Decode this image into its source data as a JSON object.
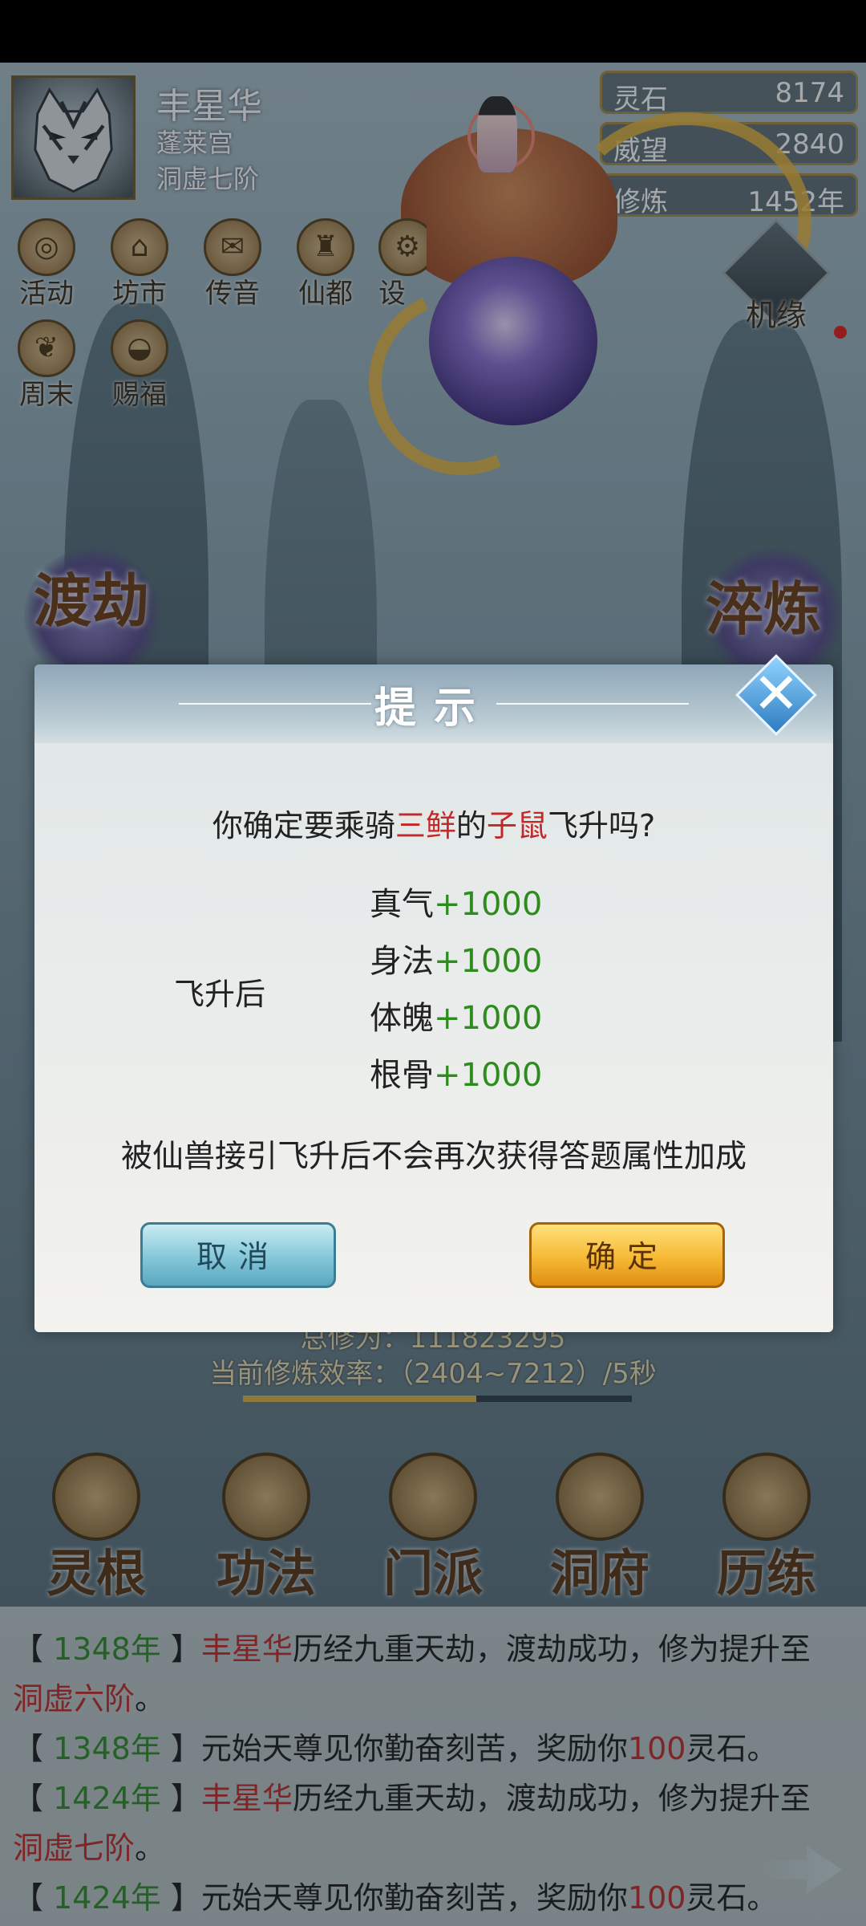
{
  "player": {
    "name": "丰星华",
    "sect": "蓬莱宫",
    "realm": "洞虚七阶"
  },
  "resources": [
    {
      "label": "灵石",
      "value": "8174"
    },
    {
      "label": "威望",
      "value": "2840"
    },
    {
      "label": "修炼",
      "value": "1452年"
    }
  ],
  "top_menu": {
    "row1": [
      "活动",
      "坊市",
      "传音",
      "仙都",
      "设"
    ],
    "row2": [
      "周末",
      "赐福"
    ],
    "jiyuan": "机缘"
  },
  "side_buttons": {
    "left": "渡劫",
    "right": "淬炼"
  },
  "cultivation": {
    "total_partial": "总修为：111823295",
    "rate": "当前修炼效率：（2404~7212）/5秒",
    "progress": 0.6
  },
  "bottom_nav": [
    "灵根",
    "功法",
    "门派",
    "洞府",
    "历练"
  ],
  "log": [
    {
      "year": "1348年",
      "name": "丰星华",
      "text": "历经九重天劫，渡劫成功，修为提升至",
      "realm": "洞虚六阶"
    },
    {
      "year": "1348年",
      "text_a": "元始天尊见你勤奋刻苦，奖励你",
      "amount": "100",
      "text_b": "灵石。"
    },
    {
      "year": "1424年",
      "name": "丰星华",
      "text": "历经九重天劫，渡劫成功，修为提升至",
      "realm": "洞虚七阶"
    },
    {
      "year": "1424年",
      "text_a": "元始天尊见你勤奋刻苦，奖励你",
      "amount": "100",
      "text_b": "灵石。"
    }
  ],
  "dialog": {
    "title": "提示",
    "question_a": "你确定要乘骑",
    "question_red1": "三鲜",
    "question_b": "的",
    "question_red2": "子鼠",
    "question_c": "飞升吗?",
    "after_label": "飞升后",
    "bonuses": [
      {
        "stat": "真气",
        "value": "+1000"
      },
      {
        "stat": "身法",
        "value": "+1000"
      },
      {
        "stat": "体魄",
        "value": "+1000"
      },
      {
        "stat": "根骨",
        "value": "+1000"
      }
    ],
    "note": "被仙兽接引飞升后不会再次获得答题属性加成",
    "cancel_label": "取消",
    "confirm_label": "确定"
  },
  "colors": {
    "green": "#2e8c1e",
    "red": "#c22a2a",
    "gold": "#d6b34a"
  }
}
